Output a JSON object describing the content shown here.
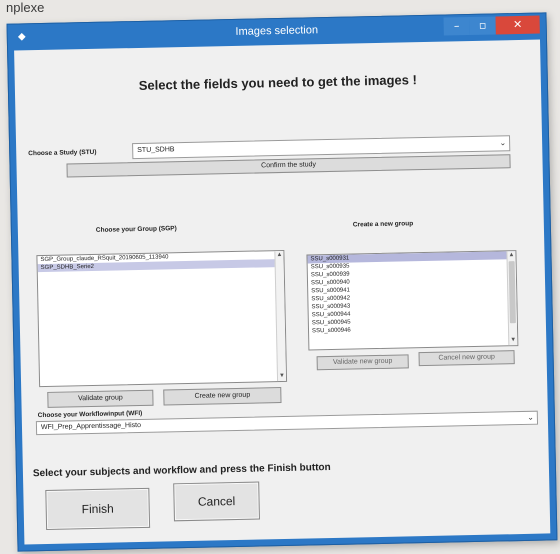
{
  "page": {
    "caption": "nplexe"
  },
  "window": {
    "title": "Images selection",
    "controls": {
      "minimize": "–",
      "maximize": "▫",
      "close": "✕"
    }
  },
  "heading": "Select the fields you need to get the images !",
  "study": {
    "label": "Choose a Study (STU)",
    "value": "STU_SDHB",
    "confirm_label": "Confirm the study"
  },
  "groups": {
    "label": "Choose your Group (SGP)",
    "items": [
      "SGP_Group_claude_RSquit_20190605_113940",
      "SGP_SDHB_Serie2"
    ],
    "validate_label": "Validate group",
    "create_label": "Create new group"
  },
  "new_group": {
    "label": "Create a new group",
    "items": [
      "SSU_s000931",
      "SSU_s000935",
      "SSU_s000939",
      "SSU_s000940",
      "SSU_s000941",
      "SSU_s000942",
      "SSU_s000943",
      "SSU_s000944",
      "SSU_s000945",
      "SSU_s000946"
    ],
    "validate_label": "Validate new group",
    "cancel_label": "Cancel new group"
  },
  "workflow": {
    "label": "Choose your Workflowinput (WFI)",
    "value": "WFI_Prep_Apprentissage_Histo"
  },
  "instruction": "Select your subjects and workflow and press the Finish button",
  "actions": {
    "finish_label": "Finish",
    "cancel_label": "Cancel"
  },
  "icons": {
    "app": "app-icon",
    "dropdown": "chevron-down-icon"
  },
  "colors": {
    "titlebar": "#2c78c6",
    "close": "#d9483b",
    "selection": "#c7c9e6"
  }
}
